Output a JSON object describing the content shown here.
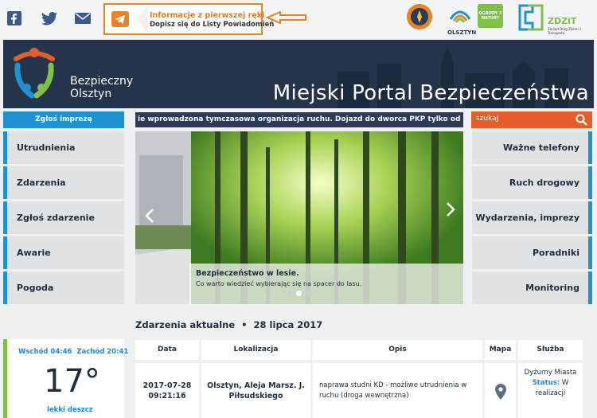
{
  "topbar": {
    "social": [
      "facebook-icon",
      "twitter-icon",
      "mail-icon"
    ],
    "notification": {
      "title": "Informacje z pierwszej ręki",
      "subtitle": "Dopisz się do Listy Powiadomień",
      "icon": "telegram-icon"
    },
    "logos": {
      "olsztyn": "OLSZTYN",
      "badge": "OGRODY Z NATURY",
      "zdzit": "ZDZiT",
      "zdzit_sub": "Zarząd Dróg Zieleni i Transportu"
    }
  },
  "banner": {
    "brand_line1": "Bezpieczny",
    "brand_line2": "Olsztyn",
    "portal_title": "Miejski Portal Bezpieczeństwa"
  },
  "left": {
    "report_event_label": "Zgłoś imprezę",
    "menu": [
      "Utrudnienia",
      "Zdarzenia",
      "Zgłoś zdarzenie",
      "Awarie",
      "Pogoda"
    ]
  },
  "ticker": "ie wprowadzona tymczasowa organizacja ruchu. Dojazd do dworca PKP tylko od Pl.Bem",
  "search": {
    "placeholder": "szukaj"
  },
  "right": {
    "menu": [
      "Ważne telefony",
      "Ruch drogowy",
      "Wydarzenia, imprezy",
      "Poradniki",
      "Monitoring"
    ]
  },
  "slider": {
    "title": "Bezpieczeństwo w lesie.",
    "subtitle": "Co warto wiedzieć wybierając się na spacer do lasu.",
    "active_dot": 1
  },
  "events": {
    "title": "Zdarzenia aktualne",
    "date": "28 lipca 2017",
    "columns": [
      "Data",
      "Lokalizacja",
      "Opis",
      "Mapa",
      "Służba"
    ],
    "rows": [
      {
        "date": "2017-07-28",
        "time": "09:21:16",
        "location": "Olsztyn, Aleja Marsz. J. Piłsudskiego",
        "desc": "naprawa studni KD - możliwe utrudnienia w ruchu (droga wewnętrzna)",
        "service": "Dyżurny Miasta",
        "status_label": "Status:",
        "status": "W realizacji"
      }
    ]
  },
  "weather": {
    "sunrise": "Wschód 04:46",
    "sunset": "Zachód 20:41",
    "temp": "17°",
    "desc": "lekki deszcz"
  },
  "colors": {
    "accent_blue": "#1f93d2",
    "accent_orange": "#e65c2c",
    "banner": "#25344b",
    "green": "#7fc04a"
  }
}
